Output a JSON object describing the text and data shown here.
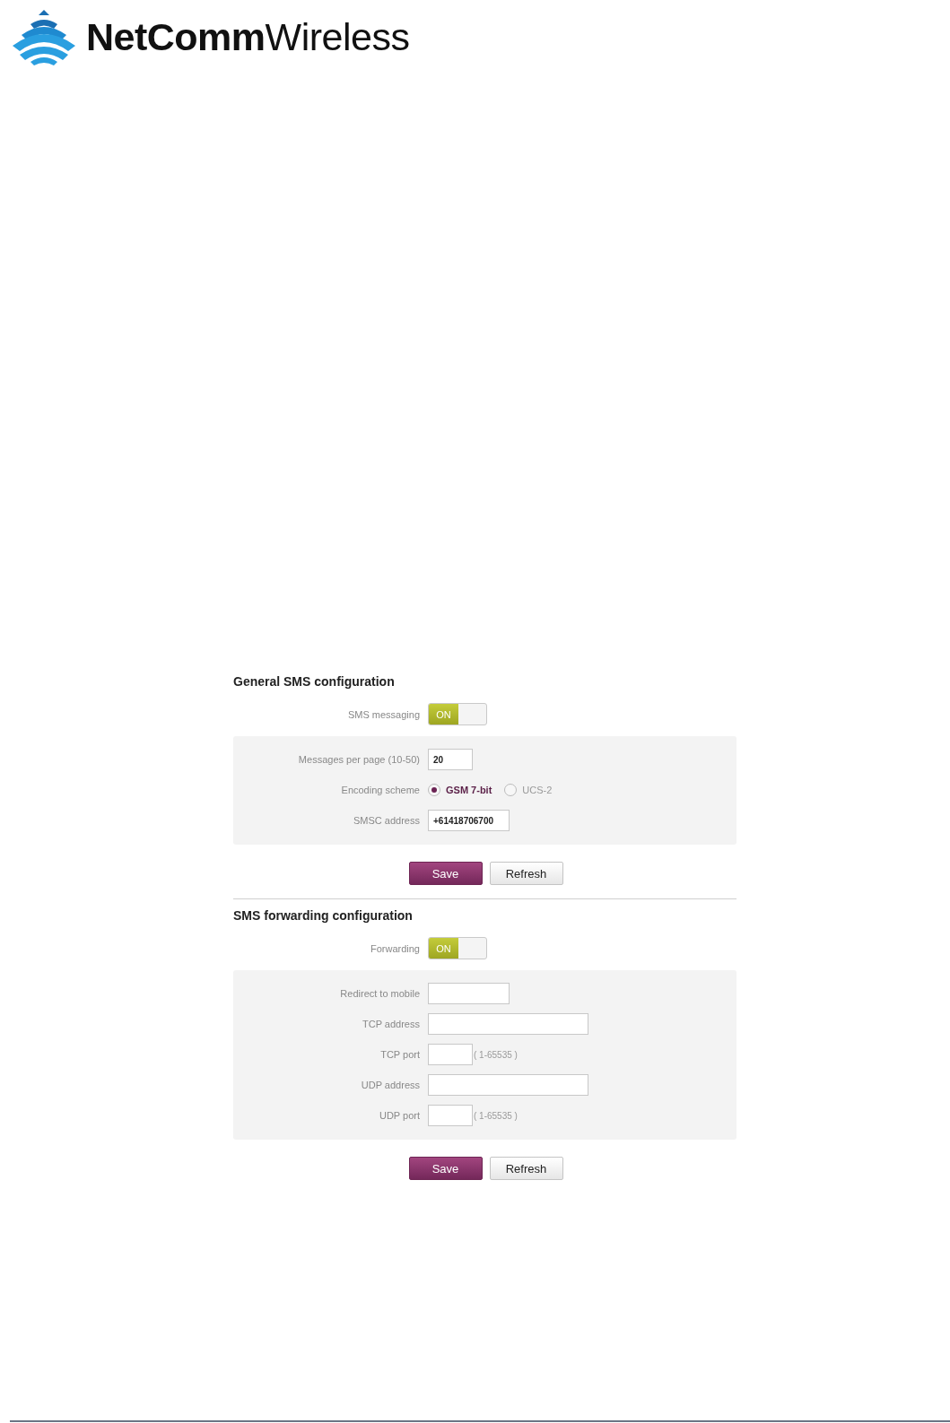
{
  "logo": {
    "brand": "NetComm",
    "suffix": "Wireless"
  },
  "sections": [
    {
      "heading": "General SMS configuration",
      "toggle": {
        "label": "SMS messaging",
        "text": "ON",
        "on": true
      },
      "fields": [
        {
          "kind": "number",
          "label": "Messages per page (10-50)",
          "value": "20"
        },
        {
          "kind": "radio",
          "label": "Encoding scheme",
          "options": [
            {
              "label": "GSM 7-bit",
              "selected": true
            },
            {
              "label": "UCS-2",
              "selected": false
            }
          ]
        },
        {
          "kind": "phone",
          "label": "SMSC address",
          "value": "+61418706700"
        }
      ],
      "buttons": [
        {
          "kind": "primary",
          "label": "Save"
        },
        {
          "kind": "secondary",
          "label": "Refresh"
        }
      ]
    },
    {
      "heading": "SMS forwarding configuration",
      "toggle": {
        "label": "Forwarding",
        "text": "ON",
        "on": true
      },
      "fields": [
        {
          "kind": "phone",
          "label": "Redirect to mobile"
        },
        {
          "kind": "address",
          "label": "TCP address"
        },
        {
          "kind": "number",
          "label": "TCP port",
          "hint": "( 1-65535 )"
        },
        {
          "kind": "address",
          "label": "UDP address"
        },
        {
          "kind": "number",
          "label": "UDP port",
          "hint": "( 1-65535 )"
        }
      ],
      "buttons": [
        {
          "kind": "primary",
          "label": "Save"
        },
        {
          "kind": "secondary",
          "label": "Refresh"
        }
      ]
    }
  ]
}
